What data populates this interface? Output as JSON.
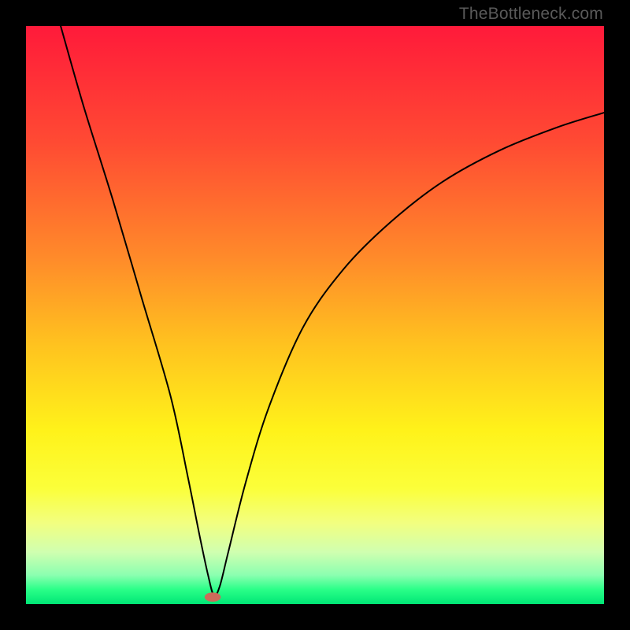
{
  "watermark": "TheBottleneck.com",
  "chart_data": {
    "type": "line",
    "title": "",
    "xlabel": "",
    "ylabel": "",
    "xlim": [
      0,
      100
    ],
    "ylim": [
      0,
      100
    ],
    "grid": false,
    "legend": false,
    "background_gradient_stops": [
      {
        "offset": 0,
        "color": "#ff1a3a"
      },
      {
        "offset": 0.2,
        "color": "#ff4a33"
      },
      {
        "offset": 0.4,
        "color": "#ff8a2a"
      },
      {
        "offset": 0.55,
        "color": "#ffc21f"
      },
      {
        "offset": 0.7,
        "color": "#fff21a"
      },
      {
        "offset": 0.8,
        "color": "#fbff3a"
      },
      {
        "offset": 0.86,
        "color": "#f2ff80"
      },
      {
        "offset": 0.91,
        "color": "#d0ffb0"
      },
      {
        "offset": 0.95,
        "color": "#8bffb0"
      },
      {
        "offset": 0.975,
        "color": "#2aff88"
      },
      {
        "offset": 1.0,
        "color": "#00e676"
      }
    ],
    "series": [
      {
        "name": "bottleneck-curve",
        "x": [
          6,
          10,
          15,
          20,
          25,
          28,
          30,
          31.5,
          32.5,
          33.5,
          35,
          38,
          42,
          48,
          55,
          63,
          72,
          82,
          92,
          100
        ],
        "y": [
          100,
          86,
          70,
          53,
          36,
          22,
          12,
          5,
          1.5,
          3,
          9,
          21,
          34,
          48,
          58,
          66,
          73,
          78.5,
          82.5,
          85
        ],
        "stroke": "#000000",
        "stroke_width": 2
      }
    ],
    "marker": {
      "name": "optimum-marker",
      "x": 32.3,
      "y": 1.2,
      "color": "#cc6b5a",
      "rx": 1.4,
      "ry": 0.8
    }
  }
}
